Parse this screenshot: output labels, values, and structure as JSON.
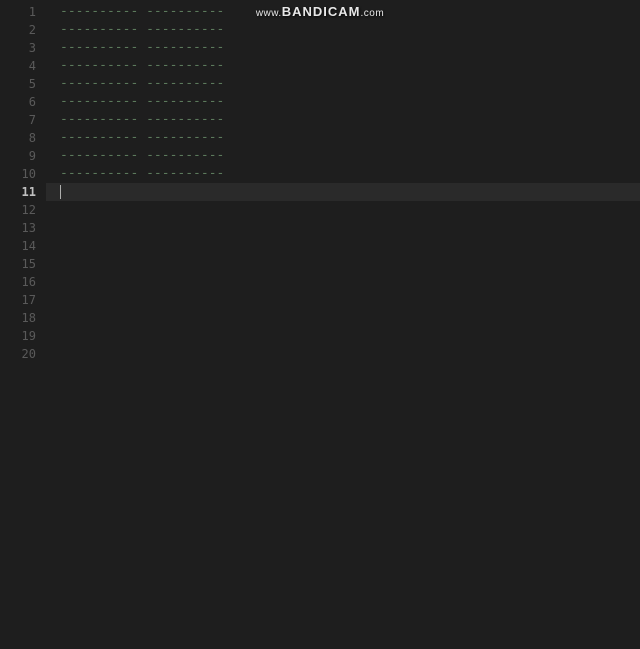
{
  "watermark": {
    "prefix": "www.",
    "brand": "BANDICAM",
    "suffix": ".com"
  },
  "editor": {
    "total_lines": 20,
    "active_line": 11,
    "content_pattern": "---------- ----------",
    "lines": [
      {
        "num": 1,
        "text": "---------- ----------"
      },
      {
        "num": 2,
        "text": "---------- ----------"
      },
      {
        "num": 3,
        "text": "---------- ----------"
      },
      {
        "num": 4,
        "text": "---------- ----------"
      },
      {
        "num": 5,
        "text": "---------- ----------"
      },
      {
        "num": 6,
        "text": "---------- ----------"
      },
      {
        "num": 7,
        "text": "---------- ----------"
      },
      {
        "num": 8,
        "text": "---------- ----------"
      },
      {
        "num": 9,
        "text": "---------- ----------"
      },
      {
        "num": 10,
        "text": "---------- ----------"
      },
      {
        "num": 11,
        "text": ""
      },
      {
        "num": 12,
        "text": ""
      },
      {
        "num": 13,
        "text": ""
      },
      {
        "num": 14,
        "text": ""
      },
      {
        "num": 15,
        "text": ""
      },
      {
        "num": 16,
        "text": ""
      },
      {
        "num": 17,
        "text": ""
      },
      {
        "num": 18,
        "text": ""
      },
      {
        "num": 19,
        "text": ""
      },
      {
        "num": 20,
        "text": ""
      }
    ]
  }
}
